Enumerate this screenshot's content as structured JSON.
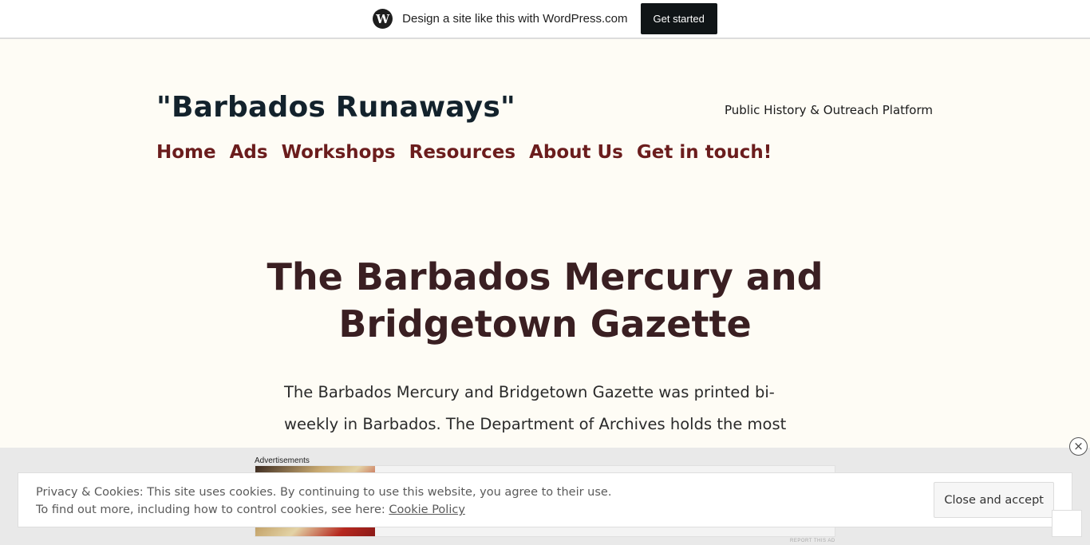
{
  "wpbar": {
    "logo_icon": "wordpress-logo-icon",
    "text": "Design a site like this with WordPress.com",
    "button_label": "Get started"
  },
  "header": {
    "site_title": "\"Barbados Runaways\"",
    "description": "Public History & Outreach Platform"
  },
  "nav": {
    "items": [
      {
        "label": "Home"
      },
      {
        "label": "Ads"
      },
      {
        "label": "Workshops"
      },
      {
        "label": "Resources"
      },
      {
        "label": "About Us"
      },
      {
        "label": "Get in touch!"
      }
    ]
  },
  "article": {
    "title": "The Barbados Mercury and Bridgetown Gazette",
    "body": "The Barbados Mercury and Bridgetown Gazette was printed bi-weekly in Barbados. The Department of Archives holds the most"
  },
  "ad": {
    "label": "Advertisements",
    "report": "REPORT THIS AD",
    "close_icon": "close-circle-icon"
  },
  "cookie": {
    "line1": "Privacy & Cookies: This site uses cookies. By continuing to use this website, you agree to their use.",
    "line2_prefix": "To find out more, including how to control cookies, see here: ",
    "link_label": "Cookie Policy",
    "button_label": "Close and accept"
  },
  "colors": {
    "page_bg": "#fefcf5",
    "nav": "#6b1d1d",
    "title": "#3a1f22",
    "site_title": "#13222c"
  }
}
